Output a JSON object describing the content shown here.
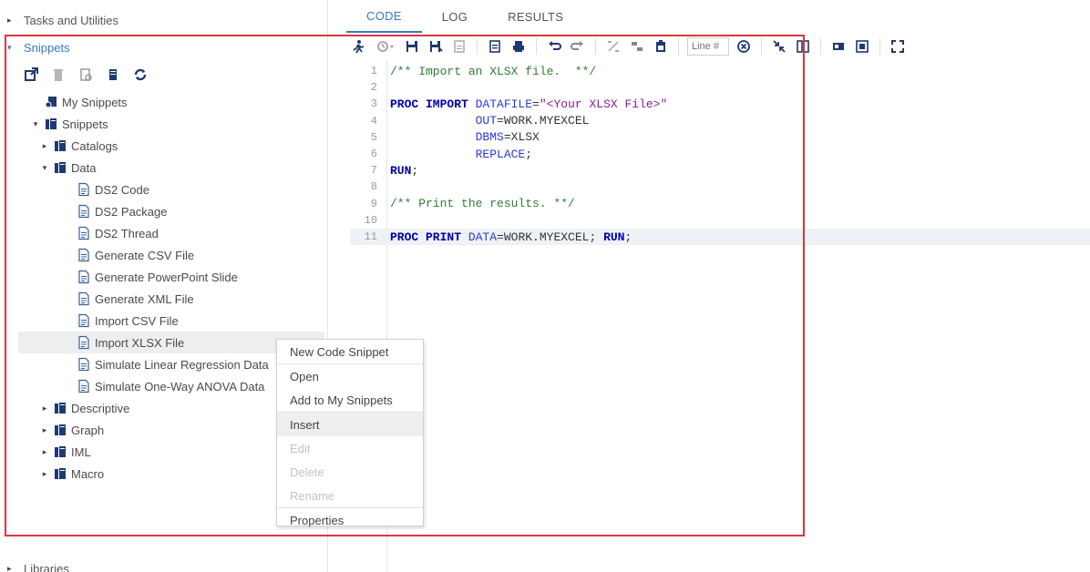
{
  "nav": {
    "tasks_label": "Tasks and Utilities",
    "snippets_label": "Snippets",
    "libraries_label": "Libraries"
  },
  "tree": [
    {
      "label": "My Snippets",
      "twisty": "",
      "icon": "my-snippets-icon",
      "level": 1
    },
    {
      "label": "Snippets",
      "twisty": "▾",
      "icon": "library-icon",
      "level": 1
    },
    {
      "label": "Catalogs",
      "twisty": "▸",
      "icon": "library-icon",
      "level": 2
    },
    {
      "label": "Data",
      "twisty": "▾",
      "icon": "library-icon",
      "level": 2
    },
    {
      "label": "DS2 Code",
      "twisty": "",
      "icon": "snippet-file-icon",
      "level": 3
    },
    {
      "label": "DS2 Package",
      "twisty": "",
      "icon": "snippet-file-icon",
      "level": 3
    },
    {
      "label": "DS2 Thread",
      "twisty": "",
      "icon": "snippet-file-icon",
      "level": 3
    },
    {
      "label": "Generate CSV File",
      "twisty": "",
      "icon": "snippet-file-icon",
      "level": 3
    },
    {
      "label": "Generate PowerPoint Slide",
      "twisty": "",
      "icon": "snippet-file-icon",
      "level": 3
    },
    {
      "label": "Generate XML File",
      "twisty": "",
      "icon": "snippet-file-icon",
      "level": 3
    },
    {
      "label": "Import CSV File",
      "twisty": "",
      "icon": "snippet-file-icon",
      "level": 3
    },
    {
      "label": "Import XLSX File",
      "twisty": "",
      "icon": "snippet-file-icon",
      "level": 3,
      "selected": true
    },
    {
      "label": "Simulate Linear Regression Data",
      "twisty": "",
      "icon": "snippet-file-icon",
      "level": 3
    },
    {
      "label": "Simulate One-Way ANOVA Data",
      "twisty": "",
      "icon": "snippet-file-icon",
      "level": 3
    },
    {
      "label": "Descriptive",
      "twisty": "▸",
      "icon": "library-icon",
      "level": 2
    },
    {
      "label": "Graph",
      "twisty": "▸",
      "icon": "library-icon",
      "level": 2
    },
    {
      "label": "IML",
      "twisty": "▸",
      "icon": "library-icon",
      "level": 2
    },
    {
      "label": "Macro",
      "twisty": "▸",
      "icon": "library-icon",
      "level": 2
    }
  ],
  "tabs": [
    "CODE",
    "LOG",
    "RESULTS"
  ],
  "editor": {
    "line_placeholder": "Line #"
  },
  "code_lines": [
    {
      "n": "1",
      "parts": [
        {
          "c": "cmt",
          "t": "/** Import an XLSX file.  **/"
        }
      ]
    },
    {
      "n": "2",
      "parts": []
    },
    {
      "n": "3",
      "parts": [
        {
          "c": "kw",
          "t": "PROC IMPORT "
        },
        {
          "c": "opt",
          "t": "DATAFILE"
        },
        {
          "c": "plain",
          "t": "="
        },
        {
          "c": "str",
          "t": "\"<Your XLSX File>\""
        }
      ]
    },
    {
      "n": "4",
      "parts": [
        {
          "c": "plain",
          "t": "            "
        },
        {
          "c": "opt",
          "t": "OUT"
        },
        {
          "c": "plain",
          "t": "=WORK.MYEXCEL"
        }
      ]
    },
    {
      "n": "5",
      "parts": [
        {
          "c": "plain",
          "t": "            "
        },
        {
          "c": "opt",
          "t": "DBMS"
        },
        {
          "c": "plain",
          "t": "=XLSX"
        }
      ]
    },
    {
      "n": "6",
      "parts": [
        {
          "c": "plain",
          "t": "            "
        },
        {
          "c": "opt",
          "t": "REPLACE"
        },
        {
          "c": "plain",
          "t": ";"
        }
      ]
    },
    {
      "n": "7",
      "parts": [
        {
          "c": "kw",
          "t": "RUN"
        },
        {
          "c": "plain",
          "t": ";"
        }
      ]
    },
    {
      "n": "8",
      "parts": []
    },
    {
      "n": "9",
      "parts": [
        {
          "c": "cmt",
          "t": "/** Print the results. **/"
        }
      ]
    },
    {
      "n": "10",
      "parts": []
    },
    {
      "n": "11",
      "parts": [
        {
          "c": "kw",
          "t": "PROC PRINT "
        },
        {
          "c": "opt",
          "t": "DATA"
        },
        {
          "c": "plain",
          "t": "=WORK.MYEXCEL; "
        },
        {
          "c": "kw",
          "t": "RUN"
        },
        {
          "c": "plain",
          "t": ";"
        }
      ],
      "highlight": true
    }
  ],
  "context_menu": [
    {
      "label": "New Code Snippet",
      "state": "normal"
    },
    {
      "sep": true
    },
    {
      "label": "Open",
      "state": "normal"
    },
    {
      "label": "Add to My Snippets",
      "state": "normal"
    },
    {
      "sep": true
    },
    {
      "label": "Insert",
      "state": "hover"
    },
    {
      "label": "Edit",
      "state": "disabled"
    },
    {
      "label": "Delete",
      "state": "disabled"
    },
    {
      "label": "Rename",
      "state": "disabled"
    },
    {
      "sep": true
    },
    {
      "label": "Properties",
      "state": "normal"
    }
  ],
  "colors": {
    "accent": "#3a78c2",
    "highlight_border": "#d9383f",
    "keyword": "#0000a8",
    "comment": "#2e7d32",
    "string": "#8a1a9b"
  }
}
